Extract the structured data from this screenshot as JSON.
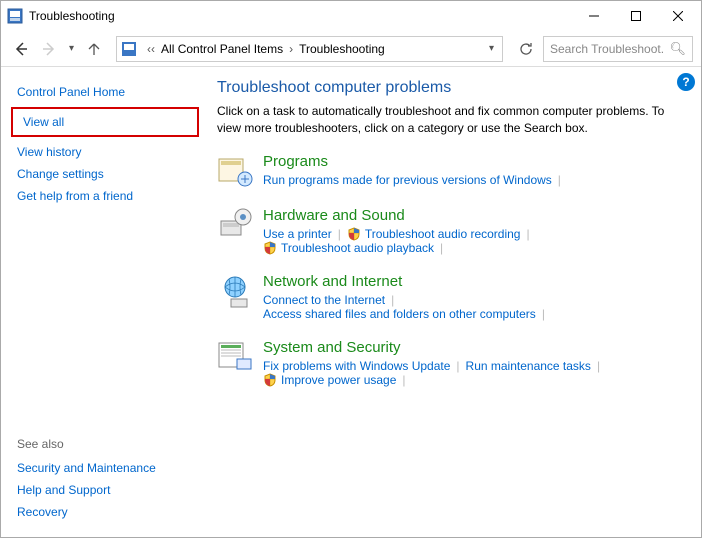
{
  "window": {
    "title": "Troubleshooting"
  },
  "address": {
    "item1": "All Control Panel Items",
    "item2": "Troubleshooting"
  },
  "search": {
    "placeholder": "Search Troubleshoot..."
  },
  "sidebar": {
    "home": "Control Panel Home",
    "viewAll": "View all",
    "history": "View history",
    "change": "Change settings",
    "help": "Get help from a friend",
    "seeAlso": "See also",
    "security": "Security and Maintenance",
    "helpSupport": "Help and Support",
    "recovery": "Recovery"
  },
  "main": {
    "title": "Troubleshoot computer problems",
    "subtitle": "Click on a task to automatically troubleshoot and fix common computer problems. To view more troubleshooters, click on a category or use the Search box.",
    "categories": {
      "programs": {
        "title": "Programs",
        "link1": "Run programs made for previous versions of Windows"
      },
      "hardware": {
        "title": "Hardware and Sound",
        "link1": "Use a printer",
        "link2": "Troubleshoot audio recording",
        "link3": "Troubleshoot audio playback"
      },
      "network": {
        "title": "Network and Internet",
        "link1": "Connect to the Internet",
        "link2": "Access shared files and folders on other computers"
      },
      "system": {
        "title": "System and Security",
        "link1": "Fix problems with Windows Update",
        "link2": "Run maintenance tasks",
        "link3": "Improve power usage"
      }
    }
  }
}
